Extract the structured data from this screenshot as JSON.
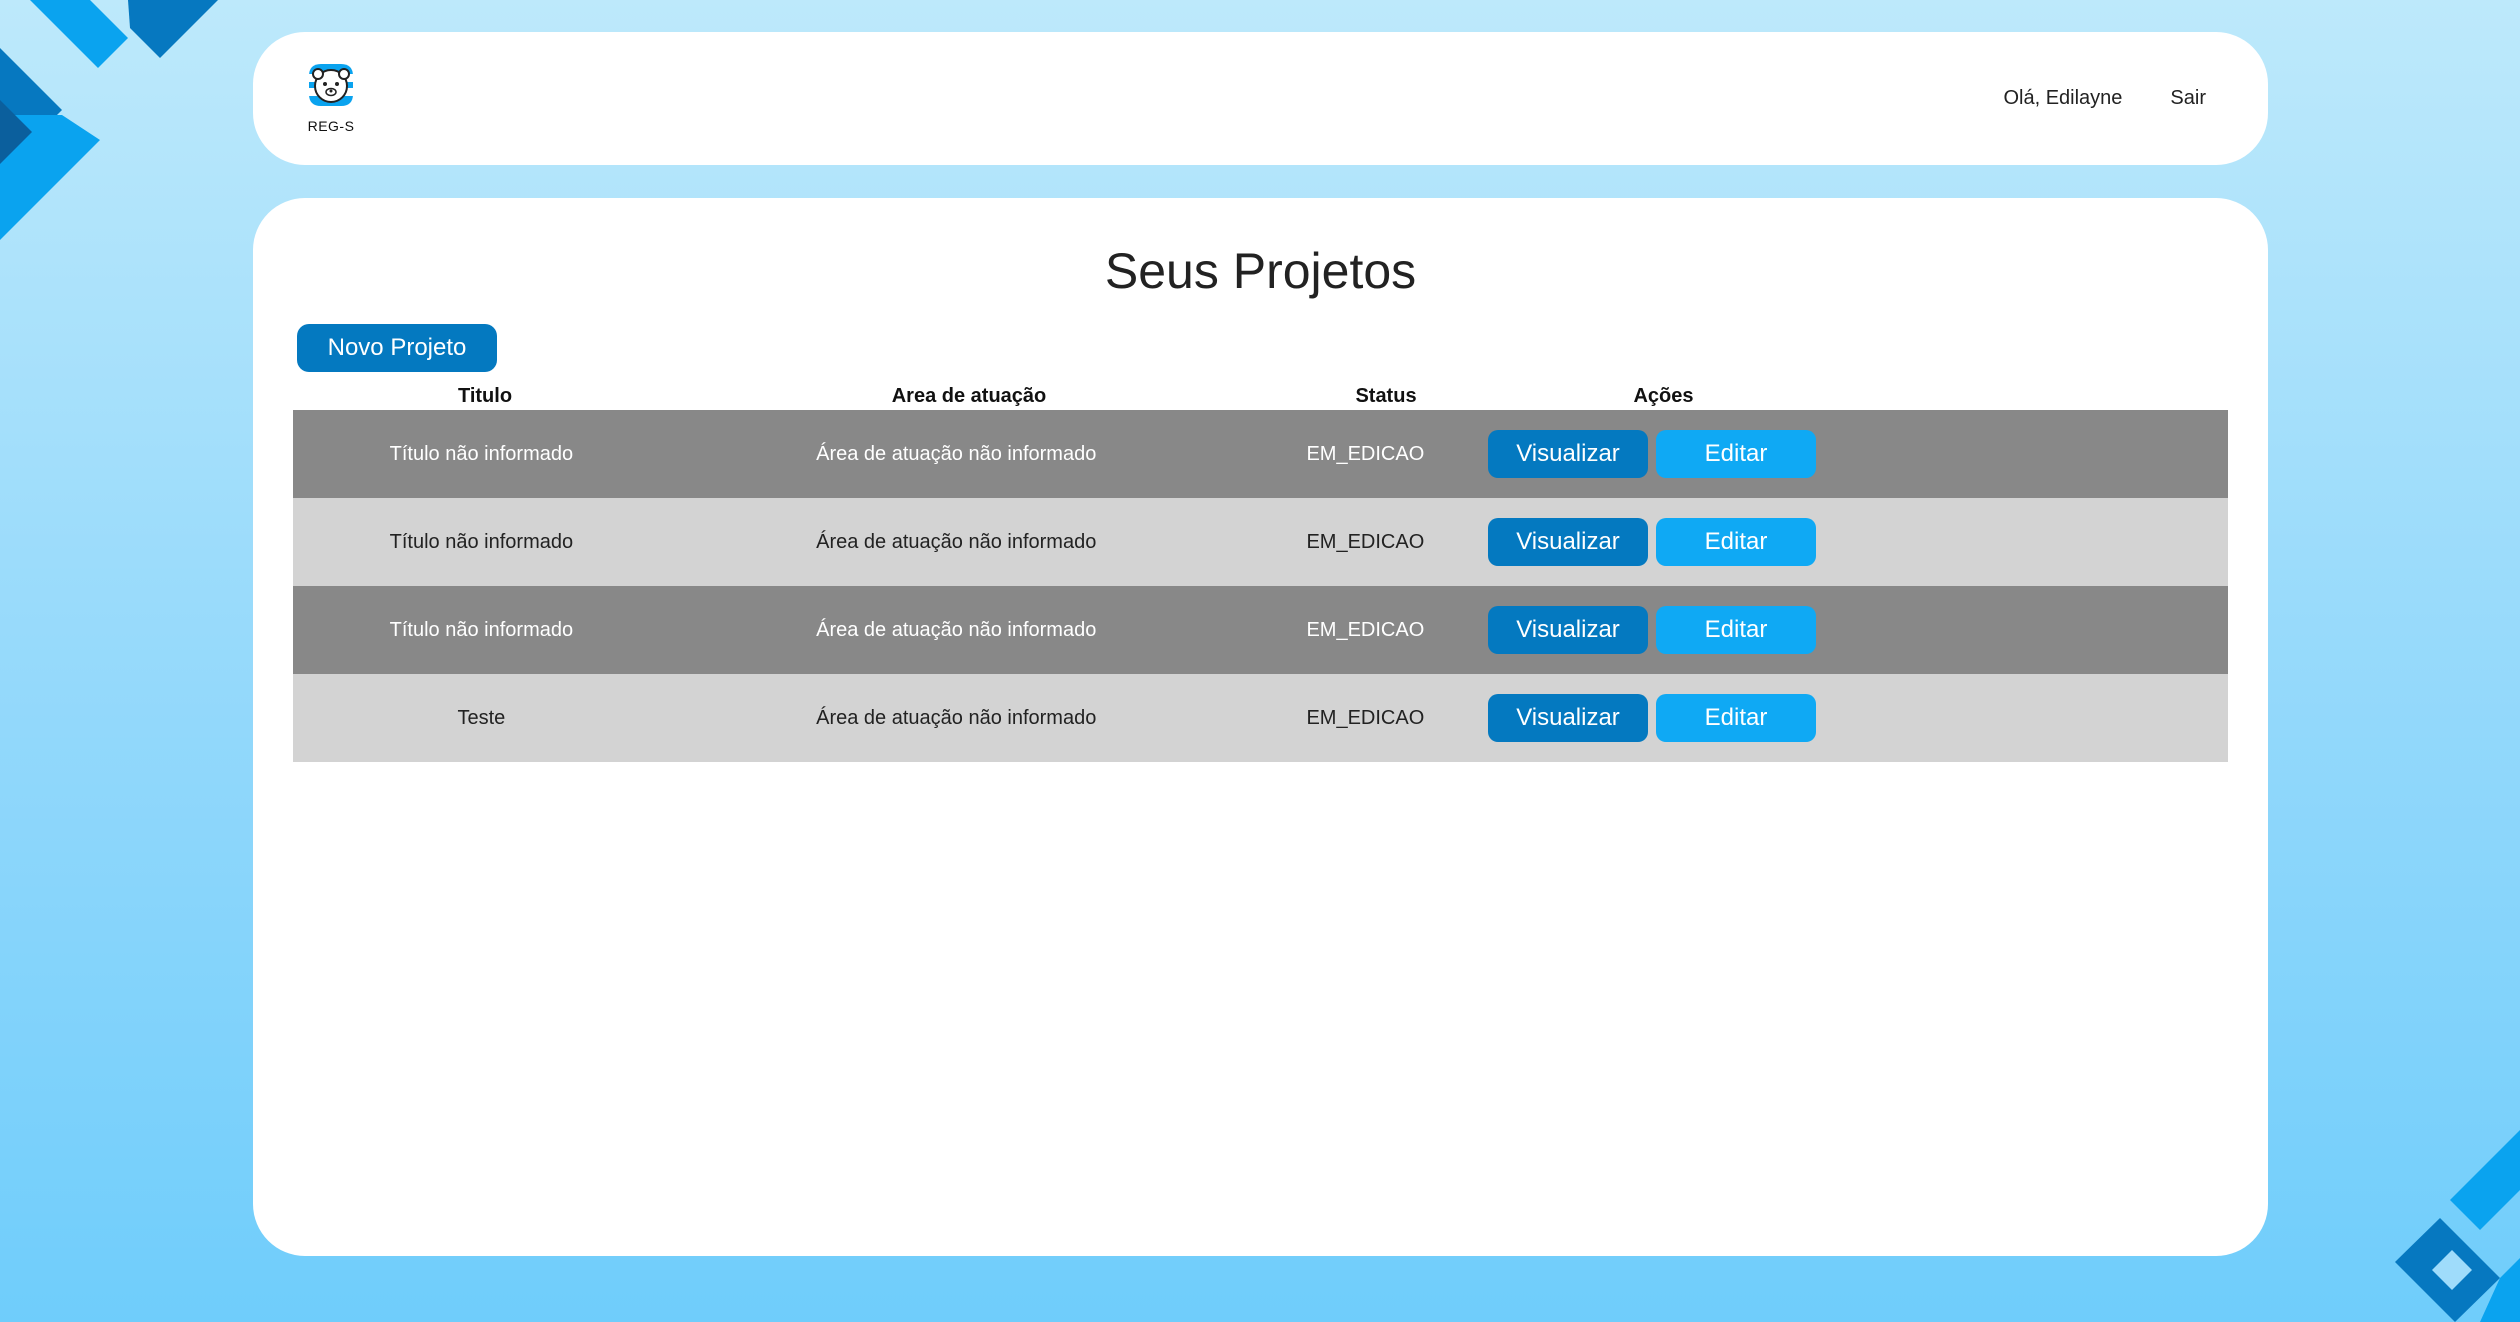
{
  "header": {
    "logo_text": "REG-S",
    "greeting": "Olá, Edilayne",
    "logout_label": "Sair"
  },
  "main": {
    "title": "Seus Projetos",
    "new_project_label": "Novo Projeto"
  },
  "table": {
    "columns": [
      "Titulo",
      "Area de atuação",
      "Status",
      "Ações"
    ],
    "rows": [
      {
        "title": "Título não informado",
        "area": "Área de atuação não informado",
        "status": "EM_EDICAO",
        "view_label": "Visualizar",
        "edit_label": "Editar"
      },
      {
        "title": "Título não informado",
        "area": "Área de atuação não informado",
        "status": "EM_EDICAO",
        "view_label": "Visualizar",
        "edit_label": "Editar"
      },
      {
        "title": "Título não informado",
        "area": "Área de atuação não informado",
        "status": "EM_EDICAO",
        "view_label": "Visualizar",
        "edit_label": "Editar"
      },
      {
        "title": "Teste",
        "area": "Área de atuação não informado",
        "status": "EM_EDICAO",
        "view_label": "Visualizar",
        "edit_label": "Editar"
      }
    ]
  },
  "colors": {
    "primary": "#0479c0",
    "secondary": "#0fa9f4",
    "row_dark": "#888888",
    "row_light": "#d3d3d3"
  },
  "icons": {
    "logo": "bear-logo-icon"
  }
}
